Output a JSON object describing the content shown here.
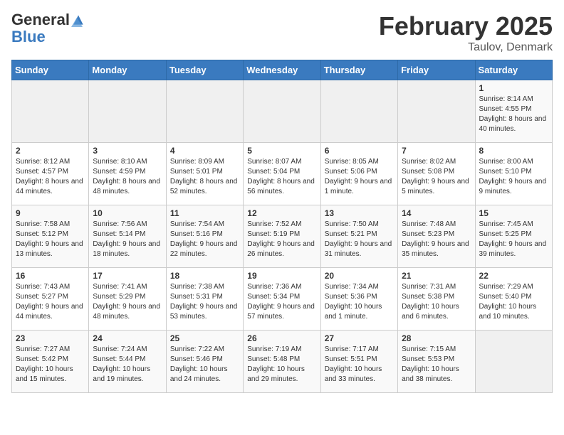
{
  "header": {
    "logo_general": "General",
    "logo_blue": "Blue",
    "title": "February 2025",
    "subtitle": "Taulov, Denmark"
  },
  "weekdays": [
    "Sunday",
    "Monday",
    "Tuesday",
    "Wednesday",
    "Thursday",
    "Friday",
    "Saturday"
  ],
  "weeks": [
    [
      {
        "day": "",
        "info": ""
      },
      {
        "day": "",
        "info": ""
      },
      {
        "day": "",
        "info": ""
      },
      {
        "day": "",
        "info": ""
      },
      {
        "day": "",
        "info": ""
      },
      {
        "day": "",
        "info": ""
      },
      {
        "day": "1",
        "info": "Sunrise: 8:14 AM\nSunset: 4:55 PM\nDaylight: 8 hours and 40 minutes."
      }
    ],
    [
      {
        "day": "2",
        "info": "Sunrise: 8:12 AM\nSunset: 4:57 PM\nDaylight: 8 hours and 44 minutes."
      },
      {
        "day": "3",
        "info": "Sunrise: 8:10 AM\nSunset: 4:59 PM\nDaylight: 8 hours and 48 minutes."
      },
      {
        "day": "4",
        "info": "Sunrise: 8:09 AM\nSunset: 5:01 PM\nDaylight: 8 hours and 52 minutes."
      },
      {
        "day": "5",
        "info": "Sunrise: 8:07 AM\nSunset: 5:04 PM\nDaylight: 8 hours and 56 minutes."
      },
      {
        "day": "6",
        "info": "Sunrise: 8:05 AM\nSunset: 5:06 PM\nDaylight: 9 hours and 1 minute."
      },
      {
        "day": "7",
        "info": "Sunrise: 8:02 AM\nSunset: 5:08 PM\nDaylight: 9 hours and 5 minutes."
      },
      {
        "day": "8",
        "info": "Sunrise: 8:00 AM\nSunset: 5:10 PM\nDaylight: 9 hours and 9 minutes."
      }
    ],
    [
      {
        "day": "9",
        "info": "Sunrise: 7:58 AM\nSunset: 5:12 PM\nDaylight: 9 hours and 13 minutes."
      },
      {
        "day": "10",
        "info": "Sunrise: 7:56 AM\nSunset: 5:14 PM\nDaylight: 9 hours and 18 minutes."
      },
      {
        "day": "11",
        "info": "Sunrise: 7:54 AM\nSunset: 5:16 PM\nDaylight: 9 hours and 22 minutes."
      },
      {
        "day": "12",
        "info": "Sunrise: 7:52 AM\nSunset: 5:19 PM\nDaylight: 9 hours and 26 minutes."
      },
      {
        "day": "13",
        "info": "Sunrise: 7:50 AM\nSunset: 5:21 PM\nDaylight: 9 hours and 31 minutes."
      },
      {
        "day": "14",
        "info": "Sunrise: 7:48 AM\nSunset: 5:23 PM\nDaylight: 9 hours and 35 minutes."
      },
      {
        "day": "15",
        "info": "Sunrise: 7:45 AM\nSunset: 5:25 PM\nDaylight: 9 hours and 39 minutes."
      }
    ],
    [
      {
        "day": "16",
        "info": "Sunrise: 7:43 AM\nSunset: 5:27 PM\nDaylight: 9 hours and 44 minutes."
      },
      {
        "day": "17",
        "info": "Sunrise: 7:41 AM\nSunset: 5:29 PM\nDaylight: 9 hours and 48 minutes."
      },
      {
        "day": "18",
        "info": "Sunrise: 7:38 AM\nSunset: 5:31 PM\nDaylight: 9 hours and 53 minutes."
      },
      {
        "day": "19",
        "info": "Sunrise: 7:36 AM\nSunset: 5:34 PM\nDaylight: 9 hours and 57 minutes."
      },
      {
        "day": "20",
        "info": "Sunrise: 7:34 AM\nSunset: 5:36 PM\nDaylight: 10 hours and 1 minute."
      },
      {
        "day": "21",
        "info": "Sunrise: 7:31 AM\nSunset: 5:38 PM\nDaylight: 10 hours and 6 minutes."
      },
      {
        "day": "22",
        "info": "Sunrise: 7:29 AM\nSunset: 5:40 PM\nDaylight: 10 hours and 10 minutes."
      }
    ],
    [
      {
        "day": "23",
        "info": "Sunrise: 7:27 AM\nSunset: 5:42 PM\nDaylight: 10 hours and 15 minutes."
      },
      {
        "day": "24",
        "info": "Sunrise: 7:24 AM\nSunset: 5:44 PM\nDaylight: 10 hours and 19 minutes."
      },
      {
        "day": "25",
        "info": "Sunrise: 7:22 AM\nSunset: 5:46 PM\nDaylight: 10 hours and 24 minutes."
      },
      {
        "day": "26",
        "info": "Sunrise: 7:19 AM\nSunset: 5:48 PM\nDaylight: 10 hours and 29 minutes."
      },
      {
        "day": "27",
        "info": "Sunrise: 7:17 AM\nSunset: 5:51 PM\nDaylight: 10 hours and 33 minutes."
      },
      {
        "day": "28",
        "info": "Sunrise: 7:15 AM\nSunset: 5:53 PM\nDaylight: 10 hours and 38 minutes."
      },
      {
        "day": "",
        "info": ""
      }
    ]
  ]
}
